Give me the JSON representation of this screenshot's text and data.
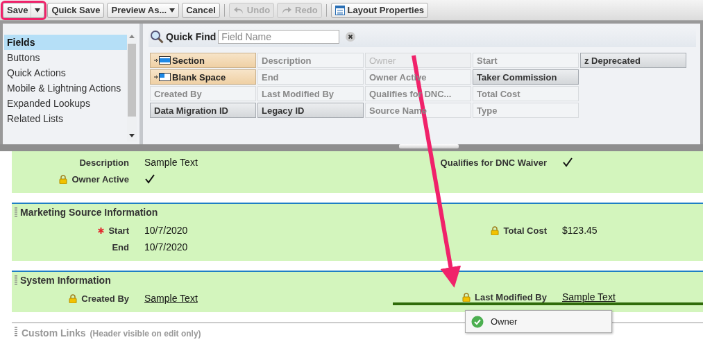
{
  "toolbar": [
    {
      "kind": "split",
      "label": "Save",
      "disabled": false,
      "highlighted": true
    },
    {
      "kind": "button",
      "label": "Quick Save",
      "disabled": false,
      "highlighted": false
    },
    {
      "kind": "dropdown",
      "label": "Preview As...",
      "disabled": false,
      "highlighted": false
    },
    {
      "kind": "button",
      "label": "Cancel",
      "disabled": false,
      "highlighted": false
    },
    {
      "kind": "separator"
    },
    {
      "kind": "undo",
      "label": "Undo",
      "disabled": true,
      "highlighted": false
    },
    {
      "kind": "redo",
      "label": "Redo",
      "disabled": true,
      "highlighted": false
    },
    {
      "kind": "separator"
    },
    {
      "kind": "properties",
      "label": "Layout Properties",
      "disabled": false,
      "highlighted": false
    }
  ],
  "palette": {
    "categories": [
      {
        "label": "Fields",
        "selected": true
      },
      {
        "label": "Buttons",
        "selected": false
      },
      {
        "label": "Quick Actions",
        "selected": false
      },
      {
        "label": "Mobile & Lightning Actions",
        "selected": false
      },
      {
        "label": "Expanded Lookups",
        "selected": false
      },
      {
        "label": "Related Lists",
        "selected": false
      }
    ],
    "quick_find": {
      "label": "Quick Find",
      "placeholder": "Field Name"
    },
    "columns": [
      [
        {
          "label": "Section",
          "kind": "section"
        },
        {
          "label": "Blank Space",
          "kind": "blank"
        },
        {
          "label": "Created By",
          "kind": "used"
        },
        {
          "label": "Data Migration ID",
          "kind": "available"
        }
      ],
      [
        {
          "label": "Description",
          "kind": "used"
        },
        {
          "label": "End",
          "kind": "used"
        },
        {
          "label": "Last Modified By",
          "kind": "used"
        },
        {
          "label": "Legacy ID",
          "kind": "available"
        }
      ],
      [
        {
          "label": "Owner",
          "kind": "dragging"
        },
        {
          "label": "Owner Active",
          "kind": "used"
        },
        {
          "label": "Qualifies for DNC...",
          "kind": "used"
        },
        {
          "label": "Source Name",
          "kind": "used"
        }
      ],
      [
        {
          "label": "Start",
          "kind": "used"
        },
        {
          "label": "Taker Commission",
          "kind": "available"
        },
        {
          "label": "Total Cost",
          "kind": "used"
        },
        {
          "label": "Type",
          "kind": "used"
        }
      ],
      [
        {
          "label": "z Deprecated",
          "kind": "available"
        }
      ]
    ]
  },
  "sections": [
    {
      "kind": "fields",
      "rows": [
        [
          {
            "label": "Description",
            "kind": "text",
            "value": "Sample Text",
            "locked": false,
            "required": false,
            "drop_target": false
          },
          {
            "label": "Qualifies for DNC Waiver",
            "kind": "checkbox",
            "checked": true,
            "locked": false,
            "required": false,
            "drop_target": false
          }
        ],
        [
          {
            "label": "Owner Active",
            "kind": "checkbox",
            "checked": true,
            "locked": true,
            "required": false,
            "drop_target": false
          }
        ]
      ]
    },
    {
      "title": "Marketing Source Information",
      "kind": "fields",
      "rows": [
        [
          {
            "label": "Start",
            "kind": "text",
            "value": "10/7/2020",
            "locked": false,
            "required": true,
            "drop_target": false
          },
          {
            "label": "Total Cost",
            "kind": "text",
            "value": "$123.45",
            "locked": true,
            "required": false,
            "drop_target": false
          }
        ],
        [
          {
            "label": "End",
            "kind": "text",
            "value": "10/7/2020",
            "locked": false,
            "required": false,
            "drop_target": false
          }
        ]
      ]
    },
    {
      "title": "System Information",
      "kind": "fields",
      "rows": [
        [
          {
            "label": "Created By",
            "kind": "link",
            "value": "Sample Text",
            "locked": true,
            "required": false,
            "drop_target": false
          },
          {
            "label": "Last Modified By",
            "kind": "link",
            "value": "Sample Text",
            "locked": true,
            "required": false,
            "drop_target": true
          }
        ]
      ]
    },
    {
      "title": "Custom Links",
      "kind": "links",
      "note": "(Header visible on edit only)"
    }
  ],
  "drag_item": {
    "label": "Owner"
  }
}
